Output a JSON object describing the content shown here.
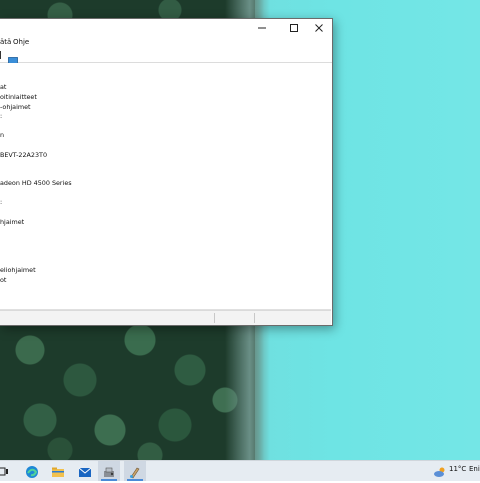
{
  "window": {
    "menus": [
      "ätä",
      "Ohje"
    ],
    "tree": [
      "at",
      "oitinlaitteet",
      "-ohjaimet",
      ":",
      "n",
      "BEVT-22A23T0",
      "",
      "adeon HD 4500 Series",
      "",
      ":",
      "hjaimet",
      "",
      "",
      "eliohjaimet",
      "ot"
    ]
  },
  "taskbar": {
    "temperature": "11°C",
    "weather_text": "Eni"
  }
}
